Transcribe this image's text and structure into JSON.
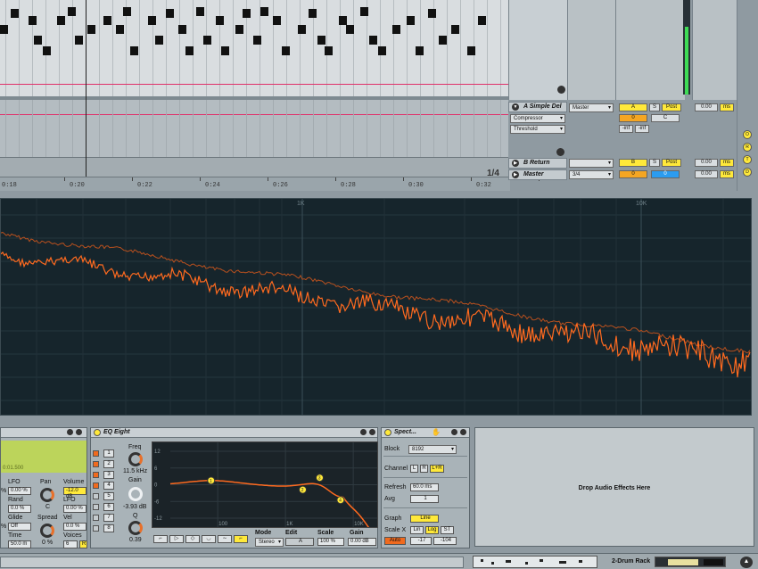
{
  "arrangement": {
    "loop_label": "1/4",
    "ruler": [
      "0:18",
      "0:20",
      "0:22",
      "0:24",
      "0:26",
      "0:28",
      "0:30",
      "0:32"
    ]
  },
  "tracks": {
    "a_return": {
      "name": "A Simple Del",
      "output": "Master",
      "send": "A",
      "solo": "S",
      "post": "Post",
      "volume": "0",
      "pan": "C",
      "device1": "Compressor",
      "device2": "Threshold",
      "meter_l": "-inf",
      "meter_r": "-inf",
      "delay_value": "0.00",
      "delay_unit": "ms"
    },
    "b_return": {
      "name": "B Return",
      "send": "B",
      "solo": "S",
      "post": "Post",
      "delay_value": "0.00",
      "delay_unit": "ms"
    },
    "master": {
      "name": "Master",
      "signature": "3/4",
      "volume": "0",
      "pan": "0",
      "delay_value": "0.00",
      "delay_unit": "ms"
    }
  },
  "side_letters": [
    "O",
    "R",
    "T",
    "D"
  ],
  "spectrum_view": {
    "freq_labels": [
      "1K",
      "10K"
    ]
  },
  "sampler": {
    "display_value": "0:01.500",
    "lfo_label": "LFO",
    "lfo_value": "0.00 %",
    "rand_label": "Rand",
    "rand_value": "0.0 %",
    "glide_label": "Glide",
    "glide_value": "Off",
    "time_label": "Time",
    "time_value": "50.0 m",
    "pan_label": "Pan",
    "pan_value": "C",
    "spread_label": "Spread",
    "spread_value": "0 %",
    "volume_label": "Volume",
    "volume_value": "-12.0 dB",
    "lfo2_label": "LFO",
    "lfo2_value": "0.00 %",
    "vel_label": "Vel",
    "vel_value": "0.0 %",
    "voices_label": "Voices",
    "voices_value": "6",
    "retrig": "R",
    "pct_left1": "%",
    "pct_left2": "%"
  },
  "eq_eight": {
    "title": "EQ Eight",
    "bands": [
      "1",
      "2",
      "3",
      "4",
      "5",
      "6",
      "7",
      "8"
    ],
    "freq_label": "Freq",
    "freq_value": "11.5 kHz",
    "gain_label": "Gain",
    "gain_value": "-3.93 dB",
    "q_label": "Q",
    "q_value": "0.39",
    "db_ticks": [
      "12",
      "6",
      "0",
      "-6",
      "-12"
    ],
    "freq_ticks": [
      "100",
      "1K",
      "10K"
    ],
    "mode_label": "Mode",
    "mode_value": "Stereo",
    "edit_label": "Edit",
    "edit_value": "A",
    "scale_label": "Scale",
    "scale_value": "100 %",
    "gain2_label": "Gain",
    "gain2_value": "0.00 dB",
    "points": [
      {
        "id": "1",
        "freq": 80,
        "gain": 1.5
      },
      {
        "id": "2",
        "freq": 1800,
        "gain": -1.8
      },
      {
        "id": "3",
        "freq": 3200,
        "gain": 2.5
      },
      {
        "id": "4",
        "freq": 6500,
        "gain": -5.5
      }
    ]
  },
  "spectrum_device": {
    "title": "Spect...",
    "block_label": "Block",
    "block_value": "8192",
    "channel_label": "Channel",
    "ch_l": "L",
    "ch_r": "R",
    "ch_lr": "L+R",
    "refresh_label": "Refresh",
    "refresh_value": "60.0 ms",
    "avg_label": "Avg",
    "avg_value": "1",
    "graph_label": "Graph",
    "graph_value": "Line",
    "scalex_label": "Scale X",
    "lin": "Lin",
    "log": "Log",
    "st": "ST",
    "auto": "Auto",
    "range_low": "-17",
    "range_high": "-104"
  },
  "drop_zone": {
    "text": "Drop Audio Effects Here"
  },
  "status": {
    "rack_name": "2-Drum Rack"
  }
}
